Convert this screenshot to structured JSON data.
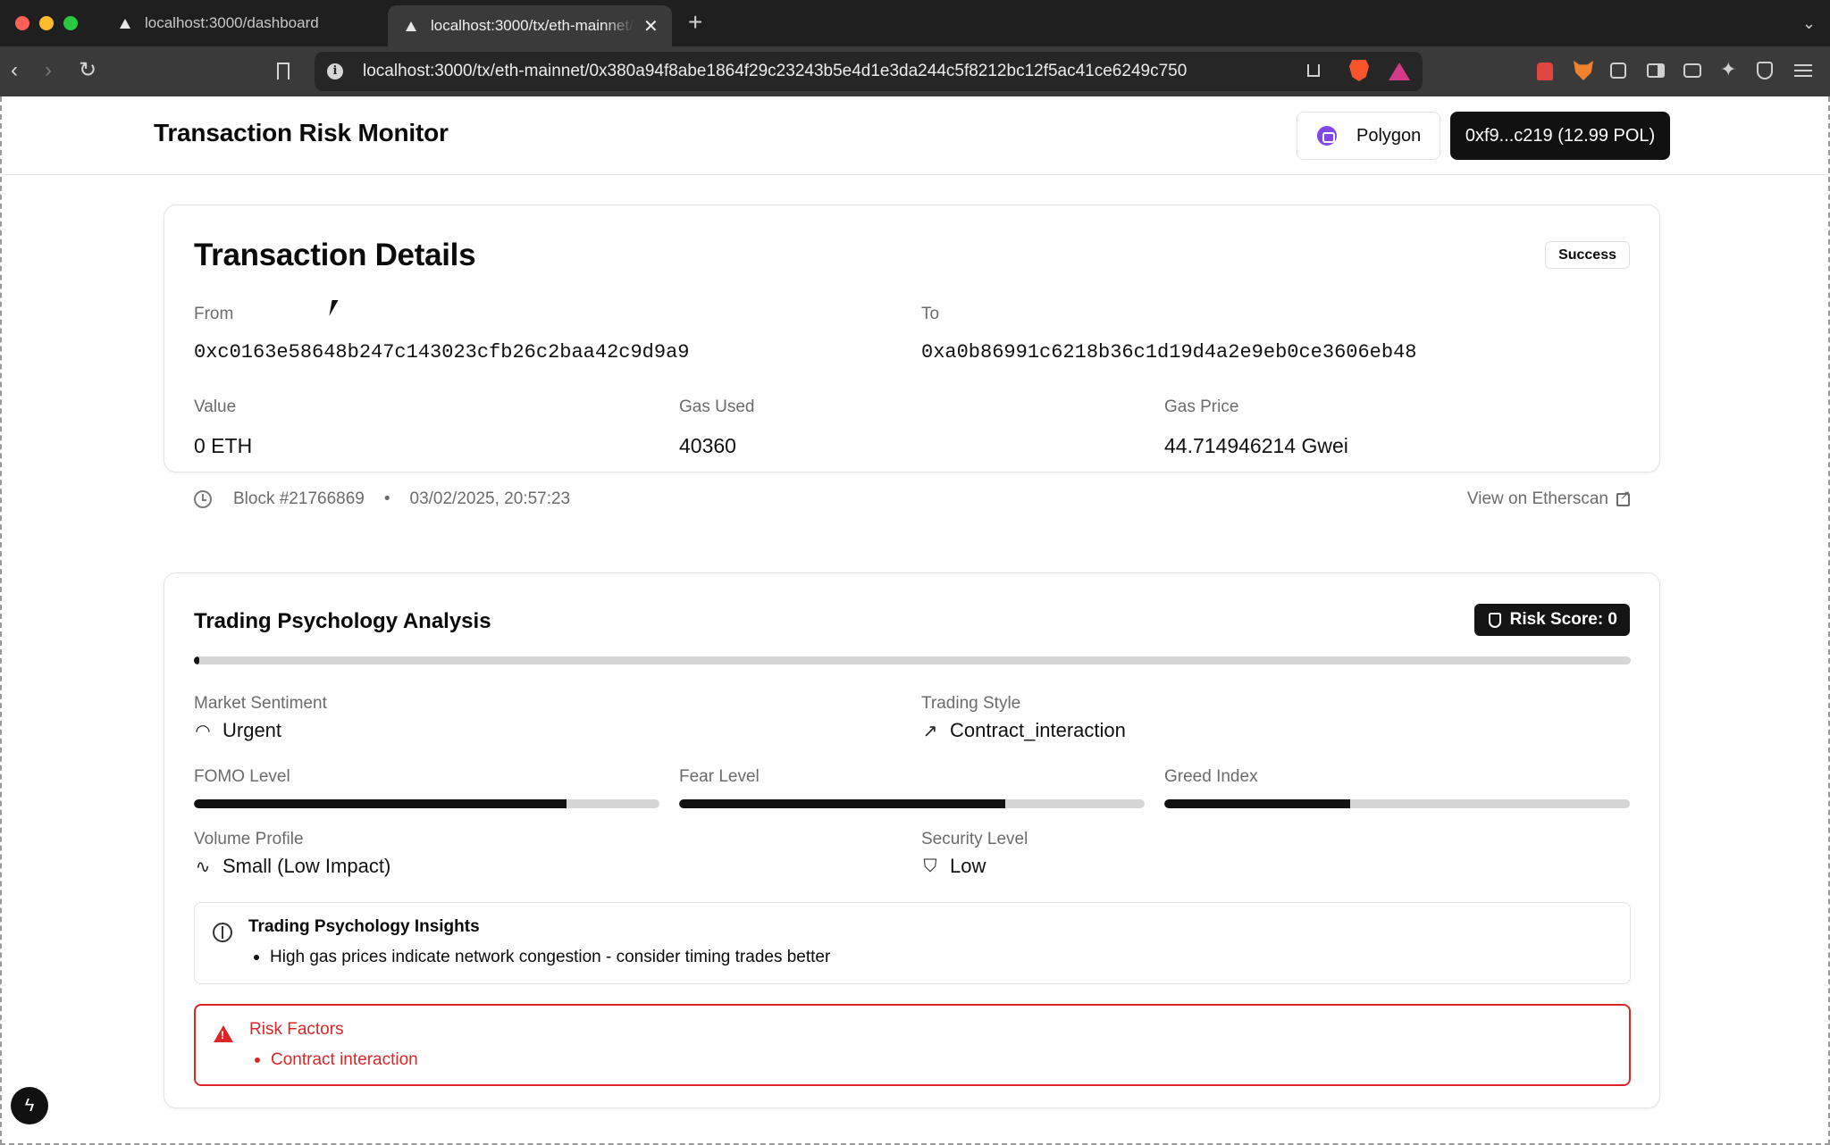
{
  "browser": {
    "tabs": [
      {
        "title": "localhost:3000/dashboard",
        "active": false
      },
      {
        "title": "localhost:3000/tx/eth-mainnet/0x380a94f8abe1864f29c23243b5e4d1e3da244c5f8212bc12f5ac41ce6249c750",
        "active": true
      }
    ],
    "new_tab": "+",
    "close_glyph": "✕",
    "url": "localhost:3000/tx/eth-mainnet/0x380a94f8abe1864f29c23243b5e4d1e3da244c5f8212bc12f5ac41ce6249c750"
  },
  "header": {
    "title": "Transaction Risk Monitor",
    "network_label": "Polygon",
    "wallet_label": "0xf9...c219 (12.99 POL)"
  },
  "transaction": {
    "title": "Transaction Details",
    "status": "Success",
    "from_label": "From",
    "from": "0xc0163e58648b247c143023cfb26c2baa42c9d9a9",
    "to_label": "To",
    "to": "0xa0b86991c6218b36c1d19d4a2e9eb0ce3606eb48",
    "value_label": "Value",
    "value": "0 ETH",
    "gas_used_label": "Gas Used",
    "gas_used": "40360",
    "gas_price_label": "Gas Price",
    "gas_price": "44.714946214 Gwei",
    "block": "Block #21766869",
    "separator": "•",
    "timestamp": "03/02/2025, 20:57:23",
    "explorer_link": "View on Etherscan"
  },
  "psychology": {
    "title": "Trading Psychology Analysis",
    "risk_score_label": "Risk Score: 0",
    "risk_score": 0,
    "market_sentiment_label": "Market Sentiment",
    "market_sentiment": "Urgent",
    "trading_style_label": "Trading Style",
    "trading_style": "Contract_interaction",
    "fomo_label": "FOMO Level",
    "fomo_level": 0.8,
    "fear_label": "Fear Level",
    "fear_level": 0.7,
    "greed_label": "Greed Index",
    "greed_index": 0.4,
    "volume_label": "Volume Profile",
    "volume": "Small (Low Impact)",
    "security_label": "Security Level",
    "security": "Low",
    "insights_title": "Trading Psychology Insights",
    "insights": [
      "High gas prices indicate network congestion - consider timing trades better"
    ],
    "risk_factors_title": "Risk Factors",
    "risk_factors": [
      "Contract interaction"
    ]
  },
  "icons": {
    "sentiment": "gauge-icon",
    "style": "trending-up-icon",
    "volume": "activity-icon",
    "security": "shield-icon",
    "insights": "brain-icon",
    "risk": "warning-triangle-icon"
  },
  "colors": {
    "danger": "#dc2626",
    "primary": "#111111",
    "polygon": "#8247e5"
  }
}
